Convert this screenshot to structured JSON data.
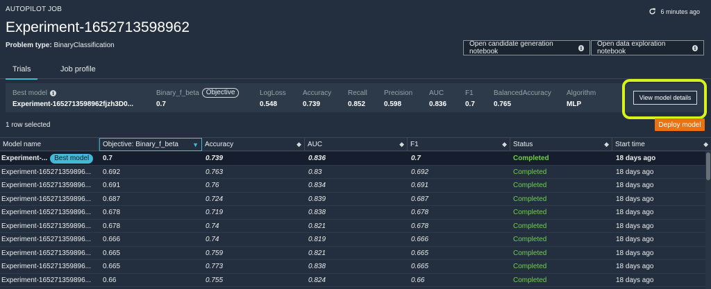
{
  "header": {
    "breadcrumb": "AUTOPILOT JOB",
    "title": "Experiment-1652713598962",
    "problem_type_label": "Problem type:",
    "problem_type_value": "BinaryClassification",
    "refresh_text": "6 minutes ago",
    "notebook_buttons": [
      "Open candidate generation notebook",
      "Open data exploration notebook"
    ]
  },
  "tabs": [
    "Trials",
    "Job profile"
  ],
  "summary": {
    "best_model_label": "Best model",
    "best_model_value": "Experiment-1652713598962fjzh3D0...",
    "objective_metric": "Binary_f_beta",
    "objective_pill": "Objective",
    "objective_value": "0.7",
    "metrics": [
      {
        "label": "LogLoss",
        "value": "0.548"
      },
      {
        "label": "Accuracy",
        "value": "0.739"
      },
      {
        "label": "Recall",
        "value": "0.852"
      },
      {
        "label": "Precision",
        "value": "0.598"
      },
      {
        "label": "AUC",
        "value": "0.836"
      },
      {
        "label": "F1",
        "value": "0.7"
      },
      {
        "label": "BalancedAccuracy",
        "value": "0.765"
      },
      {
        "label": "Algorithm",
        "value": "MLP"
      }
    ],
    "view_details_button": "View model details"
  },
  "selection_text": "1 row selected",
  "deploy_button": "Deploy model",
  "table": {
    "columns": [
      "Model name",
      "Objective: Binary_f_beta",
      "Accuracy",
      "AUC",
      "F1",
      "Status",
      "Start time"
    ],
    "best_badge": "Best model",
    "rows": [
      {
        "name": "Experiment-...",
        "objective": "0.7",
        "accuracy": "0.739",
        "auc": "0.836",
        "f1": "0.7",
        "status": "Completed",
        "start": "18 days ago"
      },
      {
        "name": "Experiment-165271359896...",
        "objective": "0.692",
        "accuracy": "0.763",
        "auc": "0.83",
        "f1": "0.692",
        "status": "Completed",
        "start": "18 days ago"
      },
      {
        "name": "Experiment-165271359896...",
        "objective": "0.691",
        "accuracy": "0.76",
        "auc": "0.834",
        "f1": "0.691",
        "status": "Completed",
        "start": "18 days ago"
      },
      {
        "name": "Experiment-165271359896...",
        "objective": "0.687",
        "accuracy": "0.724",
        "auc": "0.839",
        "f1": "0.687",
        "status": "Completed",
        "start": "18 days ago"
      },
      {
        "name": "Experiment-165271359896...",
        "objective": "0.678",
        "accuracy": "0.719",
        "auc": "0.838",
        "f1": "0.678",
        "status": "Completed",
        "start": "18 days ago"
      },
      {
        "name": "Experiment-165271359896...",
        "objective": "0.678",
        "accuracy": "0.74",
        "auc": "0.821",
        "f1": "0.678",
        "status": "Completed",
        "start": "18 days ago"
      },
      {
        "name": "Experiment-165271359896...",
        "objective": "0.666",
        "accuracy": "0.74",
        "auc": "0.819",
        "f1": "0.666",
        "status": "Completed",
        "start": "18 days ago"
      },
      {
        "name": "Experiment-165271359896...",
        "objective": "0.665",
        "accuracy": "0.759",
        "auc": "0.821",
        "f1": "0.665",
        "status": "Completed",
        "start": "18 days ago"
      },
      {
        "name": "Experiment-165271359896...",
        "objective": "0.665",
        "accuracy": "0.773",
        "auc": "0.838",
        "f1": "0.665",
        "status": "Completed",
        "start": "18 days ago"
      },
      {
        "name": "Experiment-165271359896...",
        "objective": "0.66",
        "accuracy": "0.755",
        "auc": "0.824",
        "f1": "0.66",
        "status": "Completed",
        "start": "18 days ago"
      }
    ]
  },
  "colors": {
    "background": "#232f3e",
    "accent": "#44b9d6",
    "deploy": "#ec7211",
    "status_completed": "#6fcf4f",
    "highlight": "#d8f21c"
  }
}
